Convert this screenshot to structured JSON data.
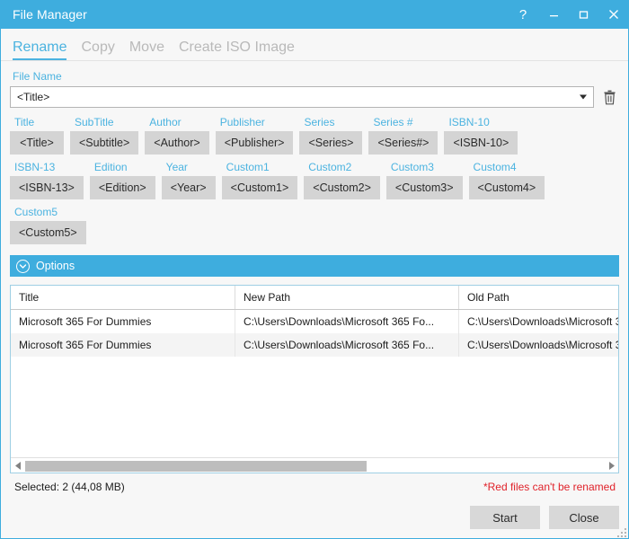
{
  "window": {
    "title": "File Manager",
    "controls": [
      {
        "name": "help-button",
        "glyph": "?"
      },
      {
        "name": "minimize-button",
        "glyph": "–"
      },
      {
        "name": "maximize-button",
        "glyph": "□"
      },
      {
        "name": "close-button",
        "glyph": "×"
      }
    ],
    "accent_color": "#3eadde",
    "body_color": "#f7f7f7"
  },
  "tabs": [
    {
      "label": "Rename",
      "active": true
    },
    {
      "label": "Copy",
      "active": false
    },
    {
      "label": "Move",
      "active": false
    },
    {
      "label": "Create ISO Image",
      "active": false
    }
  ],
  "file_name": {
    "label": "File Name",
    "value": "<Title>",
    "placeholder": "<Title>",
    "dropdown_icon": "chevron-down-icon",
    "clear_icon": "trash-icon"
  },
  "tag_rows": [
    [
      {
        "label": "Title",
        "button": "<Title>"
      },
      {
        "label": "SubTitle",
        "button": "<Subtitle>"
      },
      {
        "label": "Author",
        "button": "<Author>"
      },
      {
        "label": "Publisher",
        "button": "<Publisher>"
      },
      {
        "label": "Series",
        "button": "<Series>"
      },
      {
        "label": "Series #",
        "button": "<Series#>"
      },
      {
        "label": "ISBN-10",
        "button": "<ISBN-10>"
      }
    ],
    [
      {
        "label": "ISBN-13",
        "button": "<ISBN-13>"
      },
      {
        "label": "Edition",
        "button": "<Edition>"
      },
      {
        "label": "Year",
        "button": "<Year>"
      },
      {
        "label": "Custom1",
        "button": "<Custom1>"
      },
      {
        "label": "Custom2",
        "button": "<Custom2>"
      },
      {
        "label": "Custom3",
        "button": "<Custom3>"
      },
      {
        "label": "Custom4",
        "button": "<Custom4>"
      }
    ],
    [
      {
        "label": "Custom5",
        "button": "<Custom5>"
      }
    ]
  ],
  "options": {
    "label": "Options",
    "expander_icon": "chevron-down-circle-icon",
    "expanded": false
  },
  "table": {
    "columns": [
      "Title",
      "New Path",
      "Old Path"
    ],
    "rows": [
      {
        "title": "Microsoft 365 For Dummies",
        "new_path": "C:\\Users\\Downloads\\Microsoft 365 Fo...",
        "old_path": "C:\\Users\\Downloads\\Microsoft 3"
      },
      {
        "title": "Microsoft 365 For Dummies",
        "new_path": "C:\\Users\\Downloads\\Microsoft 365 Fo...",
        "old_path": "C:\\Users\\Downloads\\Microsoft 3"
      }
    ],
    "hscroll": {
      "left_arrow_icon": "triangle-left-icon",
      "right_arrow_icon": "triangle-right-icon"
    }
  },
  "status": {
    "selected": "Selected:  2 (44,08 MB)",
    "warning": "*Red files can't be renamed",
    "warning_color": "#e0222a"
  },
  "footer": {
    "start_label": "Start",
    "close_label": "Close",
    "resize_grip_icon": "resize-grip-icon"
  }
}
